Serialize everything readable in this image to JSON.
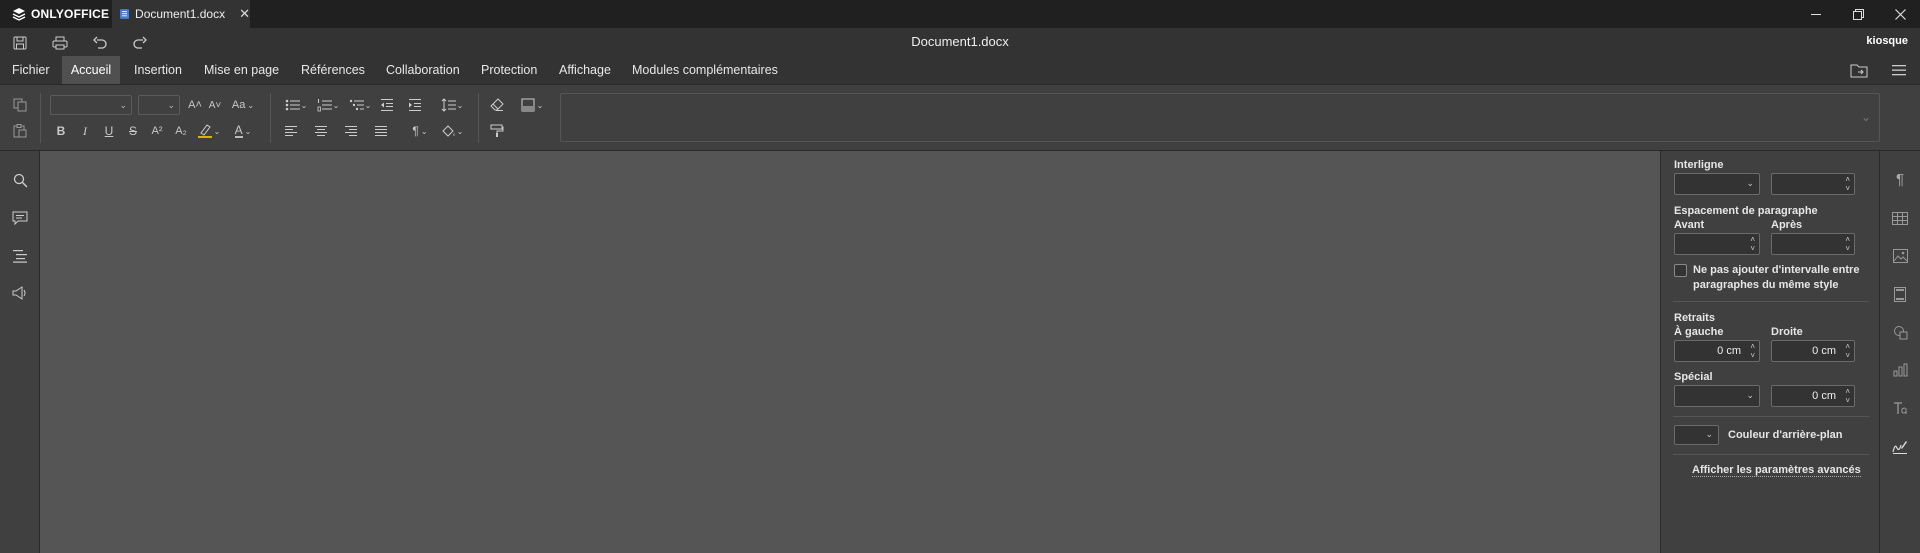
{
  "app": {
    "brand": "ONLYOFFICE",
    "tab_title": "Document1.docx",
    "doc_title": "Document1.docx",
    "username": "kiosque"
  },
  "menu": {
    "tabs": [
      "Fichier",
      "Accueil",
      "Insertion",
      "Mise en page",
      "Références",
      "Collaboration",
      "Protection",
      "Affichage",
      "Modules complémentaires"
    ],
    "active_index": 1
  },
  "toolbar": {
    "paragraph_mark": "¶",
    "font_size_up": "A˄",
    "font_size_down": "A˅",
    "change_case": "Aa",
    "bold": "B",
    "italic": "I",
    "underline": "U",
    "strikethrough": "S",
    "superscript": "A²",
    "subscript": "A₂",
    "font_color": "A"
  },
  "panel": {
    "line_spacing_label": "Interligne",
    "para_spacing_label": "Espacement de paragraphe",
    "before_label": "Avant",
    "after_label": "Après",
    "no_interval_label_1": "Ne pas ajouter d'intervalle entre",
    "no_interval_label_2": "paragraphes du même style",
    "indents_label": "Retraits",
    "left_label": "À gauche",
    "right_label": "Droite",
    "left_value": "0 cm",
    "right_value": "0 cm",
    "special_label": "Spécial",
    "special_value": "0 cm",
    "bg_color_label": "Couleur d'arrière-plan",
    "advanced_link": "Afficher les paramètres avancés"
  },
  "colors": {
    "titlebar": "#202020",
    "chrome": "#333333",
    "toolbar": "#404040",
    "canvas": "#555555",
    "highlight_underline": "#d4b800"
  }
}
